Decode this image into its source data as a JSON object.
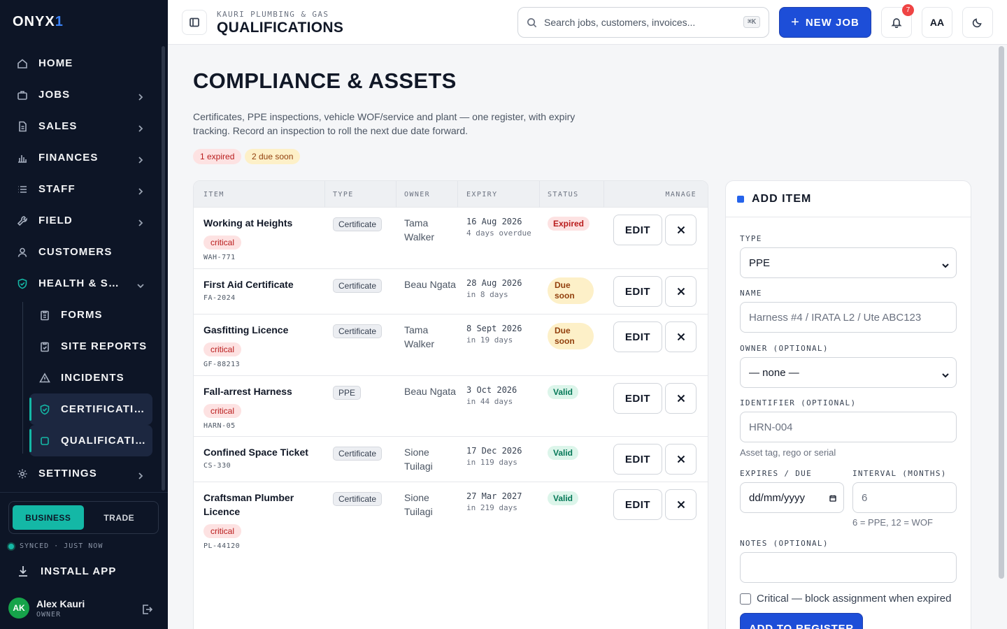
{
  "app": {
    "logo_text": "ONYX",
    "logo_accent": "1"
  },
  "sidebar": {
    "items": [
      {
        "label": "HOME",
        "icon": "home-icon"
      },
      {
        "label": "JOBS",
        "icon": "briefcase-icon"
      },
      {
        "label": "SALES",
        "icon": "document-icon"
      },
      {
        "label": "FINANCES",
        "icon": "bar-chart-icon"
      },
      {
        "label": "STAFF",
        "icon": "list-icon"
      },
      {
        "label": "FIELD",
        "icon": "wrench-icon"
      },
      {
        "label": "CUSTOMERS",
        "icon": "person-icon"
      },
      {
        "label": "HEALTH & SAFETY",
        "icon": "shield-icon"
      }
    ],
    "sub_items": [
      {
        "label": "FORMS",
        "icon": "clipboard-icon"
      },
      {
        "label": "SITE REPORTS",
        "icon": "clipboard-check-icon"
      },
      {
        "label": "INCIDENTS",
        "icon": "warning-icon"
      },
      {
        "label": "CERTIFICATIONS",
        "icon": "shield-check-icon"
      },
      {
        "label": "QUALIFICATIONS",
        "icon": "square-icon"
      }
    ],
    "settings": "SETTINGS",
    "mode": {
      "business": "BUSINESS",
      "trade": "TRADE"
    },
    "sync_status": "SYNCED · JUST NOW",
    "install": "INSTALL APP",
    "user": {
      "initials": "AK",
      "name": "Alex Kauri",
      "role": "OWNER"
    }
  },
  "header": {
    "org": "KAURI PLUMBING & GAS",
    "title": "QUALIFICATIONS",
    "search_placeholder": "Search jobs, customers, invoices...",
    "shortcut": "⌘K",
    "new_job": "NEW JOB",
    "notifications": "7",
    "font_toggle": "AA"
  },
  "page": {
    "title": "COMPLIANCE & ASSETS",
    "description": "Certificates, PPE inspections, vehicle WOF/service and plant — one register, with expiry tracking. Record an inspection to roll the next due date forward.",
    "expired_badge": "1 expired",
    "due_badge": "2 due soon"
  },
  "table": {
    "headers": {
      "item": "ITEM",
      "type": "TYPE",
      "owner": "OWNER",
      "expiry": "EXPIRY",
      "status": "STATUS",
      "manage": "MANAGE"
    },
    "edit_label": "EDIT",
    "rows": [
      {
        "name": "Working at Heights",
        "critical": "critical",
        "identifier": "WAH-771",
        "type": "Certificate",
        "owner": "Tama Walker",
        "expiry": "16 Aug 2026",
        "relative": "4 days overdue",
        "status": "Expired",
        "status_kind": "expired"
      },
      {
        "name": "First Aid Certificate",
        "critical": "",
        "identifier": "FA-2024",
        "type": "Certificate",
        "owner": "Beau Ngata",
        "expiry": "28 Aug 2026",
        "relative": "in 8 days",
        "status": "Due soon",
        "status_kind": "due"
      },
      {
        "name": "Gasfitting Licence",
        "critical": "critical",
        "identifier": "GF-88213",
        "type": "Certificate",
        "owner": "Tama Walker",
        "expiry": "8 Sept 2026",
        "relative": "in 19 days",
        "status": "Due soon",
        "status_kind": "due"
      },
      {
        "name": "Fall-arrest Harness",
        "critical": "critical",
        "identifier": "HARN-05",
        "type": "PPE",
        "owner": "Beau Ngata",
        "expiry": "3 Oct 2026",
        "relative": "in 44 days",
        "status": "Valid",
        "status_kind": "valid"
      },
      {
        "name": "Confined Space Ticket",
        "critical": "",
        "identifier": "CS-330",
        "type": "Certificate",
        "owner": "Sione Tuilagi",
        "expiry": "17 Dec 2026",
        "relative": "in 119 days",
        "status": "Valid",
        "status_kind": "valid"
      },
      {
        "name": "Craftsman Plumber Licence",
        "critical": "critical",
        "identifier": "PL-44120",
        "type": "Certificate",
        "owner": "Sione Tuilagi",
        "expiry": "27 Mar 2027",
        "relative": "in 219 days",
        "status": "Valid",
        "status_kind": "valid"
      }
    ]
  },
  "form": {
    "title": "ADD ITEM",
    "type_label": "TYPE",
    "type_value": "PPE",
    "name_label": "NAME",
    "name_placeholder": "Harness #4 / IRATA L2 / Ute ABC123",
    "owner_label": "OWNER (OPTIONAL)",
    "owner_value": "— none —",
    "identifier_label": "IDENTIFIER (OPTIONAL)",
    "identifier_placeholder": "HRN-004",
    "identifier_help": "Asset tag, rego or serial",
    "expires_label": "EXPIRES / DUE",
    "expires_placeholder": "dd/mm/yyyy",
    "interval_label": "INTERVAL (MONTHS)",
    "interval_placeholder": "6",
    "interval_help": "6 = PPE, 12 = WOF",
    "notes_label": "NOTES (OPTIONAL)",
    "critical_label": "Critical — block assignment when expired",
    "submit": "ADD TO REGISTER"
  },
  "colors": {
    "primary": "#1d4ed8",
    "accent": "#14b8a6",
    "sidebar": "#0d1526",
    "danger": "#b91c1c",
    "warning": "#92400e",
    "success": "#047857"
  }
}
